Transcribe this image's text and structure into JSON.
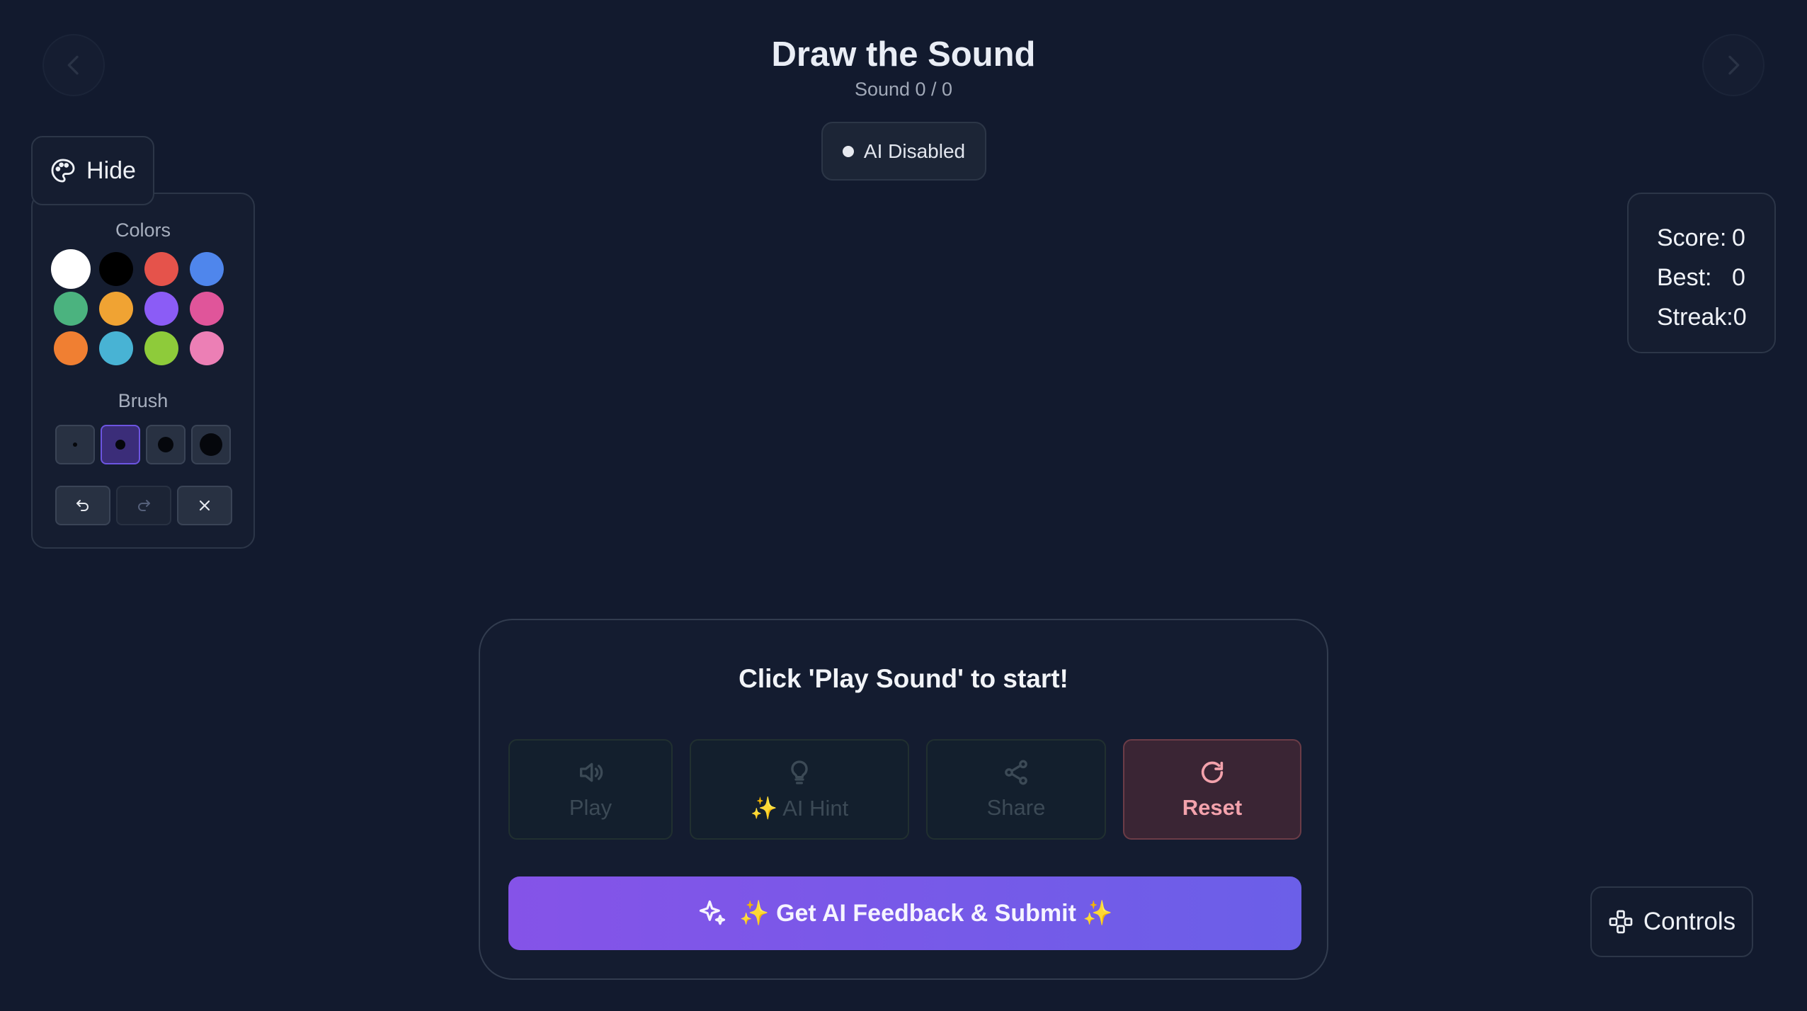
{
  "header": {
    "title": "Draw the Sound",
    "subtitle": "Sound 0 / 0"
  },
  "ai_status": {
    "label": "AI Disabled"
  },
  "tool_panel": {
    "toggle_label": "Hide",
    "colors_label": "Colors",
    "brush_label": "Brush",
    "colors": [
      "#ffffff",
      "#000000",
      "#e5534b",
      "#4f86ec",
      "#4bb37f",
      "#f0a333",
      "#8b5cf6",
      "#e0559a",
      "#f07f32",
      "#48b3d4",
      "#8ecb3a",
      "#ec7fb5"
    ],
    "selected_color": "#ffffff",
    "brush_sizes": [
      "xs",
      "sm",
      "md",
      "lg"
    ],
    "selected_brush": "sm",
    "edit_buttons": [
      "undo-icon",
      "redo-icon",
      "clear-icon"
    ]
  },
  "score": {
    "score_label": "Score:",
    "score_value": "0",
    "best_label": "Best:",
    "best_value": "0",
    "streak_label": "Streak:",
    "streak_value": "0"
  },
  "play_panel": {
    "prompt": "Click 'Play Sound' to start!",
    "play_label": "Play",
    "hint_label": "✨ AI Hint",
    "share_label": "Share",
    "reset_label": "Reset",
    "submit_label": "✨ Get AI Feedback & Submit ✨"
  },
  "controls": {
    "label": "Controls"
  },
  "colors": {
    "background": "#121a2e",
    "accent": "#7c5ce8",
    "reset": "#f3a2ac"
  }
}
